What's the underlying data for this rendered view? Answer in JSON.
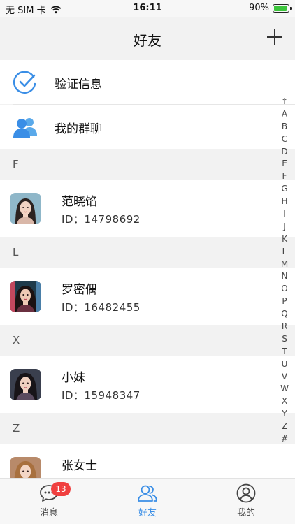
{
  "status_bar": {
    "carrier": "无 SIM 卡",
    "time": "16:11",
    "battery_percent": "90%",
    "battery_level": 0.9
  },
  "nav": {
    "title": "好友"
  },
  "menu": [
    {
      "label": "验证信息",
      "icon": "check-circle-icon"
    },
    {
      "label": "我的群聊",
      "icon": "group-icon"
    }
  ],
  "sections": [
    {
      "letter": "F",
      "contacts": [
        {
          "name": "范晓馅",
          "id_text": "ID：14798692"
        }
      ]
    },
    {
      "letter": "L",
      "contacts": [
        {
          "name": "罗密偶",
          "id_text": "ID：16482455"
        }
      ]
    },
    {
      "letter": "X",
      "contacts": [
        {
          "name": "小妹",
          "id_text": "ID：15948347"
        }
      ]
    },
    {
      "letter": "Z",
      "contacts": [
        {
          "name": "张女士",
          "id_text": ""
        }
      ]
    }
  ],
  "index_letters": [
    "↑",
    "A",
    "B",
    "C",
    "D",
    "E",
    "F",
    "G",
    "H",
    "I",
    "J",
    "K",
    "L",
    "M",
    "N",
    "O",
    "P",
    "Q",
    "R",
    "S",
    "T",
    "U",
    "V",
    "W",
    "X",
    "Y",
    "Z",
    "#"
  ],
  "tabs": [
    {
      "label": "消息",
      "icon": "chat-icon",
      "badge": "13",
      "active": false
    },
    {
      "label": "好友",
      "icon": "friends-icon",
      "active": true
    },
    {
      "label": "我的",
      "icon": "profile-icon",
      "active": false
    }
  ],
  "colors": {
    "accent": "#3a8ee6",
    "badge": "#f04040",
    "battery": "#3cc43c"
  }
}
